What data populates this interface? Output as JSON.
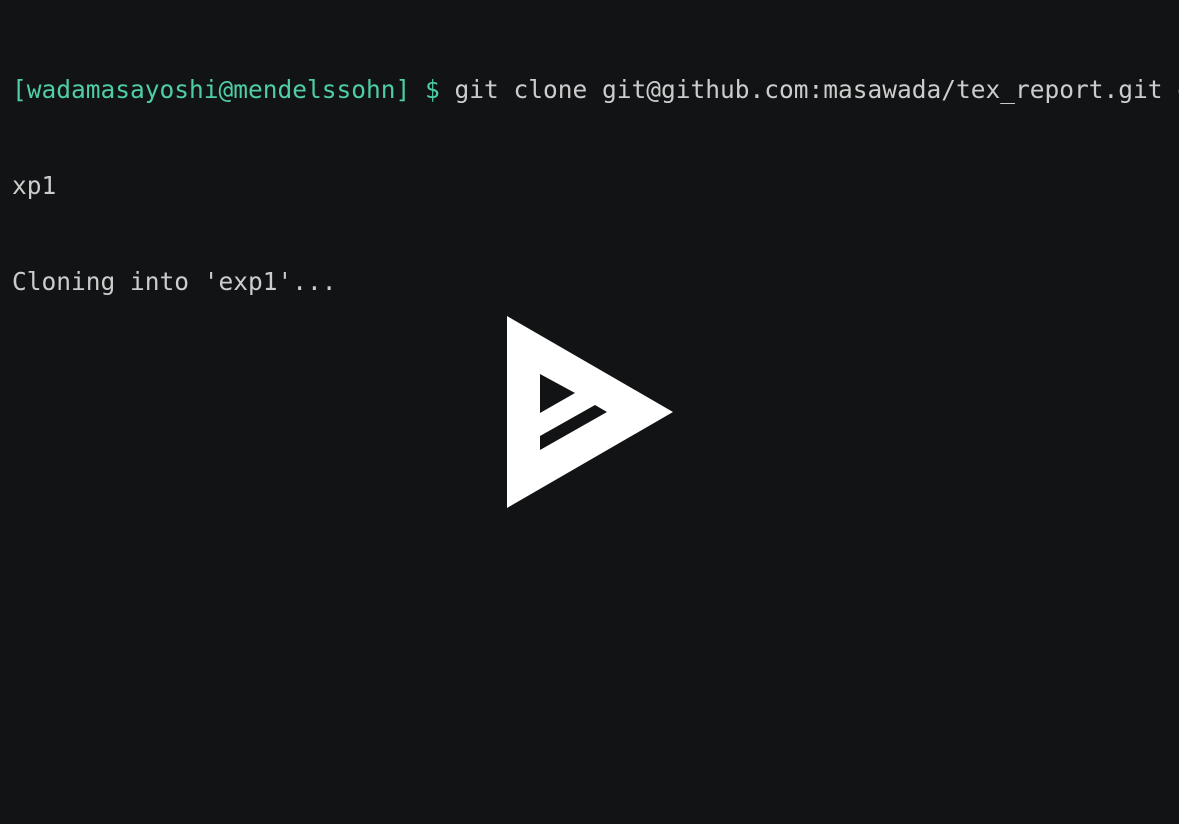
{
  "terminal": {
    "prompt": {
      "open_bracket": "[",
      "user_host": "wadamasayoshi@mendelssohn",
      "close_bracket_and_symbol": "] $",
      "color": "#4ecda7"
    },
    "command_line_1": " git clone git@github.com:masawada/tex_report.git e",
    "command_line_2": "xp1",
    "output_line": "Cloning into 'exp1'...",
    "text_color": "#cccccc",
    "background_color": "#121314"
  },
  "player": {
    "overlay_icon": "asciinema-play-icon",
    "icon_color": "#ffffff"
  }
}
